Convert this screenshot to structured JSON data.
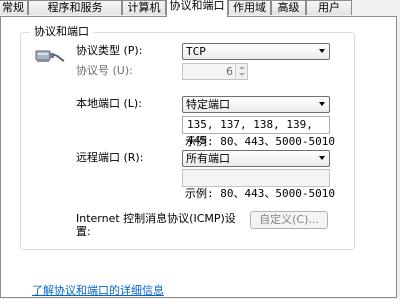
{
  "tabs": [
    {
      "label": "常规",
      "active": false
    },
    {
      "label": "程序和服务",
      "active": false
    },
    {
      "label": "计算机",
      "active": false
    },
    {
      "label": "协议和端口",
      "active": true
    },
    {
      "label": "作用域",
      "active": false
    },
    {
      "label": "高级",
      "active": false
    },
    {
      "label": "用户",
      "active": false
    }
  ],
  "group": {
    "title": "协议和端口",
    "icon": "network-cable-icon"
  },
  "protocol_type": {
    "label": "协议类型 (P):",
    "value": "TCP"
  },
  "protocol_number": {
    "label": "协议号 (U):",
    "value": "6"
  },
  "local_port": {
    "label": "本地端口 (L):",
    "selected": "特定端口",
    "value": "135, 137, 138, 139, 445",
    "example": "示例: 80、443、5000-5010"
  },
  "remote_port": {
    "label": "远程端口 (R):",
    "selected": "所有端口",
    "value": "",
    "example": "示例: 80、443、5000-5010"
  },
  "icmp": {
    "label_line1": "Internet 控制消息协议(ICMP)设",
    "label_line2": "置:",
    "button": "自定义(C)..."
  },
  "help_link": "了解协议和端口的详细信息",
  "colors": {
    "link": "#0066cc",
    "panel": "#ffffff",
    "background": "#f0f0f0"
  }
}
